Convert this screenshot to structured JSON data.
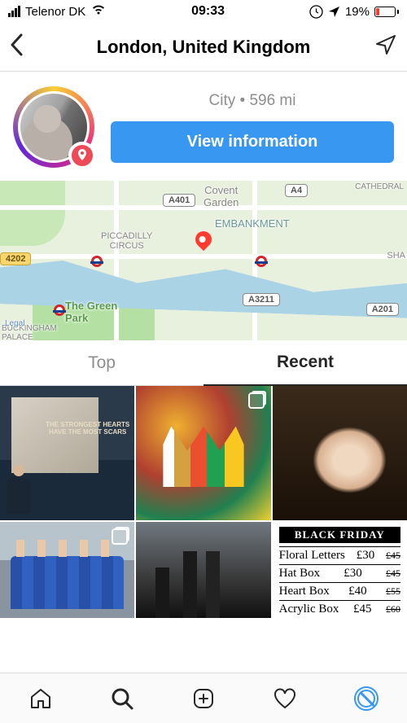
{
  "status": {
    "carrier": "Telenor DK",
    "time": "09:33",
    "battery_pct": "19%"
  },
  "header": {
    "title": "London, United Kingdom"
  },
  "location": {
    "category": "City",
    "distance": "596 mi",
    "meta_text": "City • 596 mi",
    "cta_label": "View information"
  },
  "map": {
    "labels": {
      "covent": "Covent\nGarden",
      "embankment": "EMBANKMENT",
      "piccadilly": "PICCADILLY\nCIRCUS",
      "green_park": "The Green\nPark",
      "buckingham": "BUCKINGHAM\nPALACE",
      "cathedral": "CATHEDRAL",
      "legal": "Legal",
      "sha": "SHA"
    },
    "shields": {
      "a401": "A401",
      "a4": "A4",
      "a4202": "4202",
      "a3211": "A3211",
      "a201": "A201"
    }
  },
  "tabs": {
    "top": "Top",
    "recent": "Recent",
    "active": "recent"
  },
  "posts": {
    "c1_quote": "THE STRONGEST HEARTS HAVE THE MOST SCARS",
    "c6": {
      "banner": "BLACK FRIDAY",
      "rows": [
        {
          "name": "Floral Letters",
          "price": "£30",
          "old": "£45"
        },
        {
          "name": "Hat Box",
          "price": "£30",
          "old": "£45"
        },
        {
          "name": "Heart Box",
          "price": "£40",
          "old": "£55"
        },
        {
          "name": "Acrylic Box",
          "price": "£45",
          "old": "£60"
        }
      ]
    }
  }
}
